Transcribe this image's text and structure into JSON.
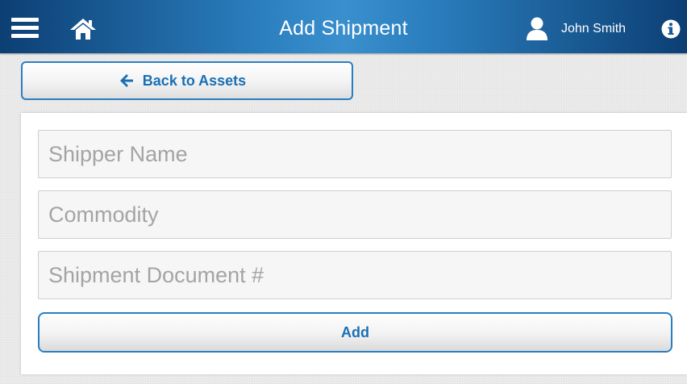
{
  "header": {
    "title": "Add Shipment",
    "user_name": "John Smith",
    "menu_icon": "hamburger-menu-icon",
    "home_icon": "home-icon",
    "user_icon": "user-icon",
    "info_icon": "info-icon"
  },
  "back_button": {
    "label": "Back to Assets",
    "icon": "arrow-left-icon"
  },
  "form": {
    "fields": [
      {
        "placeholder": "Shipper Name",
        "value": ""
      },
      {
        "placeholder": "Commodity",
        "value": ""
      },
      {
        "placeholder": "Shipment Document #",
        "value": ""
      }
    ],
    "submit_label": "Add"
  },
  "colors": {
    "header_dark": "#0c3f74",
    "header_light": "#3a8fcd",
    "accent": "#1a6fb4",
    "button_border": "#2a7ec0",
    "background": "#ececec"
  }
}
